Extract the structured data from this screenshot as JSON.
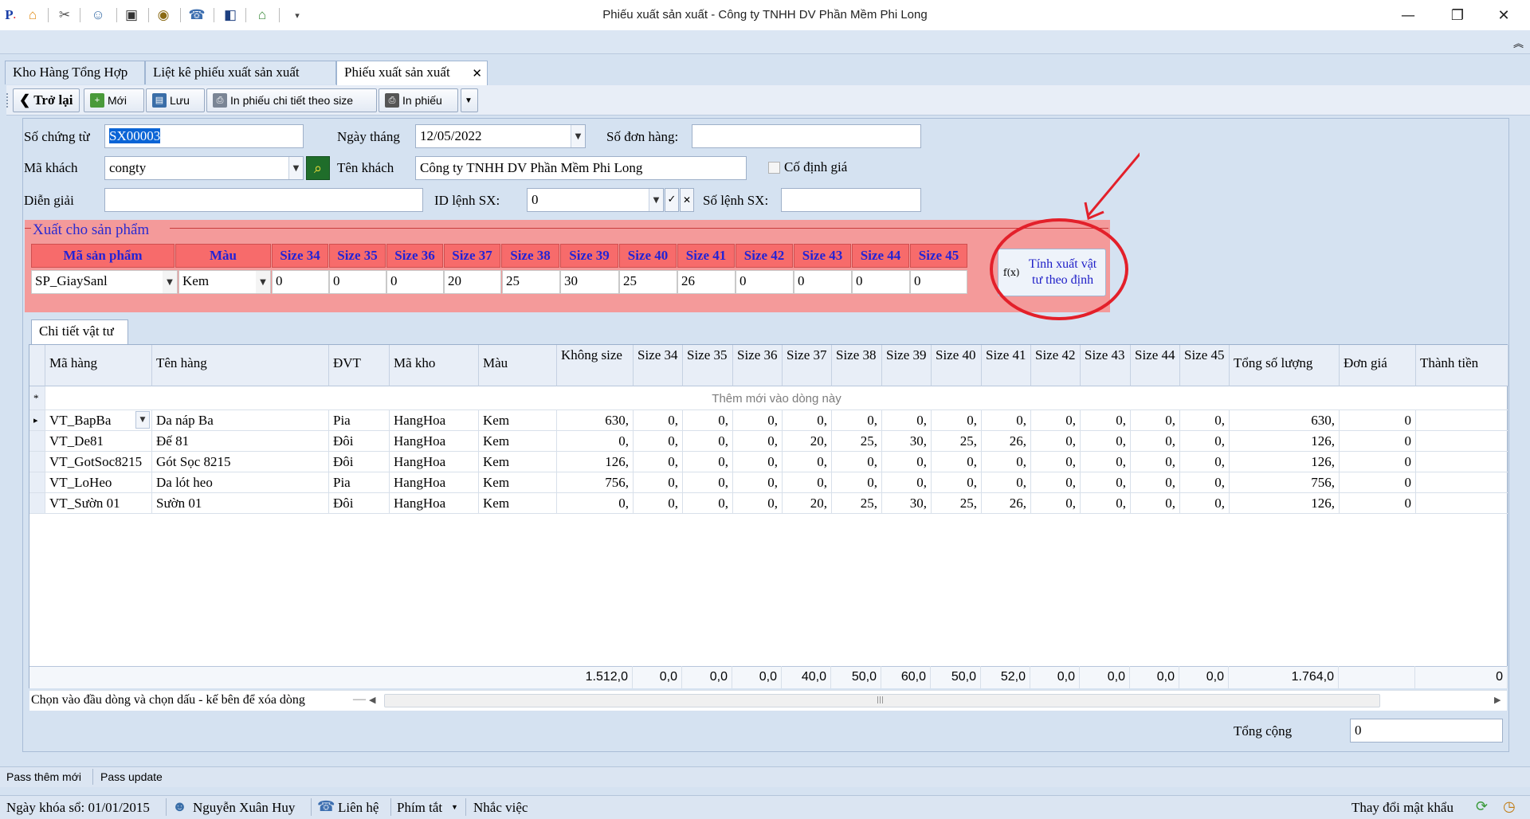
{
  "window": {
    "title": "Phiếu xuất sản xuất - Công ty TNHH DV Phần Mềm Phi Long",
    "minimize": "—",
    "maximize": "❐",
    "close": "✕"
  },
  "tabs": [
    {
      "label": "Kho Hàng Tổng Hợp"
    },
    {
      "label": "Liệt kê phiếu xuất sản xuất"
    },
    {
      "label": "Phiếu xuất sản xuất",
      "close": "✕"
    }
  ],
  "toolbar": {
    "back": "Trở lại",
    "new": "Mới",
    "save": "Lưu",
    "print_detail": "In phiếu chi tiết theo size",
    "print": "In phiếu"
  },
  "form": {
    "voucher_label": "Số chứng từ",
    "voucher_value": "SX00003",
    "date_label": "Ngày tháng",
    "date_value": "12/05/2022",
    "order_label": "Số đơn hàng:",
    "order_value": "",
    "customer_code_label": "Mã khách",
    "customer_code_value": "congty",
    "customer_name_label": "Tên khách",
    "customer_name_value": "Công ty TNHH DV Phần Mềm Phi Long",
    "fixed_price_label": "Cố định giá",
    "description_label": "Diễn giải",
    "description_value": "",
    "order_id_label": "ID lệnh SX:",
    "order_id_value": "0",
    "order_no_label": "Số lệnh SX:",
    "order_no_value": ""
  },
  "product_panel": {
    "title": "Xuất cho sản phẩm",
    "headers": [
      "Mã sản phẩm",
      "Màu",
      "Size 34",
      "Size 35",
      "Size 36",
      "Size 37",
      "Size 38",
      "Size 39",
      "Size 40",
      "Size 41",
      "Size 42",
      "Size 43",
      "Size 44",
      "Size 45"
    ],
    "values": [
      "SP_GiaySanl",
      "Kem",
      "0",
      "0",
      "0",
      "20",
      "25",
      "30",
      "25",
      "26",
      "0",
      "0",
      "0",
      "0"
    ],
    "calc_button": "Tính xuất vật tư theo định",
    "calc_icon": "f(x)"
  },
  "detail_tab": "Chi tiết vật tư",
  "grid": {
    "headers": [
      "Mã hàng",
      "Tên hàng",
      "ĐVT",
      "Mã kho",
      "Màu",
      "Không size",
      "Size 34",
      "Size 35",
      "Size 36",
      "Size 37",
      "Size 38",
      "Size 39",
      "Size 40",
      "Size 41",
      "Size 42",
      "Size 43",
      "Size 44",
      "Size 45",
      "Tổng số lượng",
      "Đơn giá",
      "Thành tiền"
    ],
    "new_row_text": "Thêm mới vào dòng này",
    "new_row_marker": "*",
    "current_row_marker": "▸",
    "rows": [
      [
        "VT_BapBa",
        "Da náp Ba",
        "Pia",
        "HangHoa",
        "Kem",
        "630,",
        "0,",
        "0,",
        "0,",
        "0,",
        "0,",
        "0,",
        "0,",
        "0,",
        "0,",
        "0,",
        "0,",
        "0,",
        "630,",
        "0",
        ""
      ],
      [
        "VT_De81",
        "Đế 81",
        "Đôi",
        "HangHoa",
        "Kem",
        "0,",
        "0,",
        "0,",
        "0,",
        "20,",
        "25,",
        "30,",
        "25,",
        "26,",
        "0,",
        "0,",
        "0,",
        "0,",
        "126,",
        "0",
        ""
      ],
      [
        "VT_GotSoc8215",
        "Gót Sọc 8215",
        "Đôi",
        "HangHoa",
        "Kem",
        "126,",
        "0,",
        "0,",
        "0,",
        "0,",
        "0,",
        "0,",
        "0,",
        "0,",
        "0,",
        "0,",
        "0,",
        "0,",
        "126,",
        "0",
        ""
      ],
      [
        "VT_LoHeo",
        "Da lót heo",
        "Pia",
        "HangHoa",
        "Kem",
        "756,",
        "0,",
        "0,",
        "0,",
        "0,",
        "0,",
        "0,",
        "0,",
        "0,",
        "0,",
        "0,",
        "0,",
        "0,",
        "756,",
        "0",
        ""
      ],
      [
        "VT_Sườn 01",
        "Sườn 01",
        "Đôi",
        "HangHoa",
        "Kem",
        "0,",
        "0,",
        "0,",
        "0,",
        "20,",
        "25,",
        "30,",
        "25,",
        "26,",
        "0,",
        "0,",
        "0,",
        "0,",
        "126,",
        "0",
        ""
      ]
    ],
    "totals": [
      "1.512,0",
      "0,0",
      "0,0",
      "0,0",
      "40,0",
      "50,0",
      "60,0",
      "50,0",
      "52,0",
      "0,0",
      "0,0",
      "0,0",
      "0,0",
      "1.764,0",
      "",
      "0"
    ],
    "hint": "Chọn vào đầu dòng và chọn dấu - kế bên để xóa dòng",
    "hint_sep": "—"
  },
  "total": {
    "label": "Tổng cộng",
    "value": "0"
  },
  "status1": {
    "pass_new": "Pass thêm mới",
    "pass_update": "Pass update"
  },
  "status2": {
    "lock_date": "Ngày khóa sổ: 01/01/2015",
    "user": "Nguyễn Xuân Huy",
    "contact": "Liên hệ",
    "shortcuts": "Phím tắt",
    "reminder": "Nhắc việc",
    "change_password": "Thay đổi mật khẩu"
  },
  "colors": {
    "accent_red": "#e3202a",
    "panel_bg": "#f49a9a",
    "header_red": "#f76b6b",
    "blue_text": "#2323d6"
  }
}
